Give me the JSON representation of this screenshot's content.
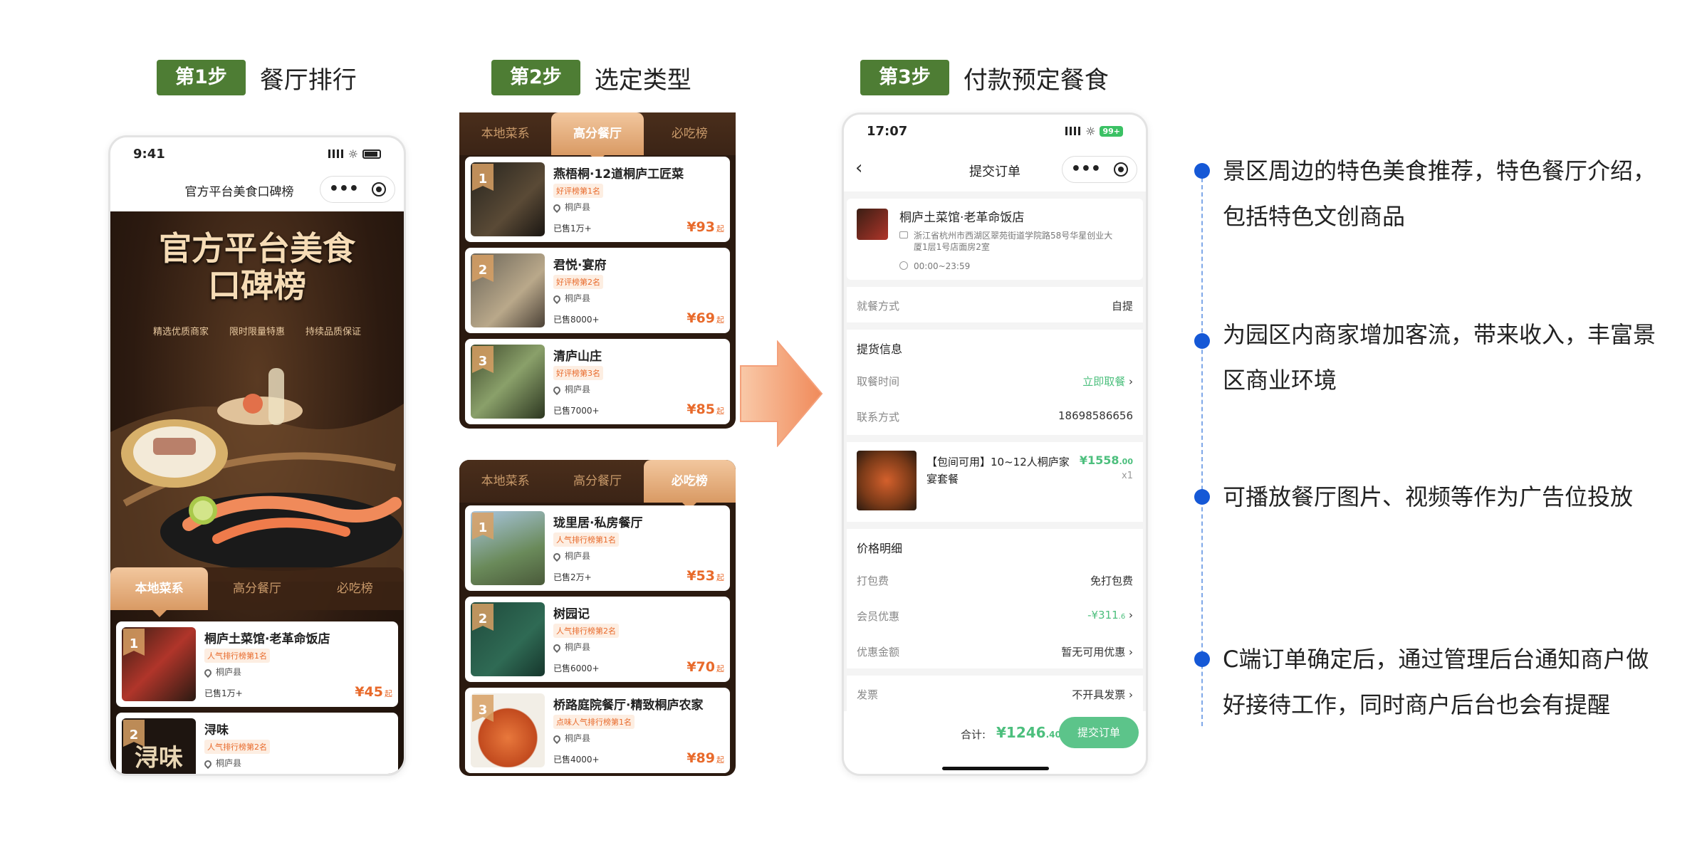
{
  "steps": [
    {
      "badge": "第1步",
      "title": "餐厅排行"
    },
    {
      "badge": "第2步",
      "title": "选定类型"
    },
    {
      "badge": "第3步",
      "title": "付款预定餐食"
    }
  ],
  "phone1": {
    "time": "9:41",
    "nav_title": "官方平台美食口碑榜",
    "hero_title_line1": "官方平台美食",
    "hero_title_line2": "口碑榜",
    "hero_tags": [
      "精选优质商家",
      "限时限量特惠",
      "持续品质保证"
    ],
    "tabs": [
      "本地菜系",
      "高分餐厅",
      "必吃榜"
    ],
    "active_tab": 0,
    "items": [
      {
        "rank": "1",
        "name": "桐庐土菜馆·老革命饭店",
        "tag": "人气排行榜第1名",
        "location": "桐庐县",
        "sold": "已售1万+",
        "price": "¥45",
        "unit": "起"
      },
      {
        "rank": "2",
        "name": "浔味",
        "tag": "人气排行榜第2名",
        "location": "桐庐县",
        "sold": "",
        "price": "",
        "unit": ""
      }
    ],
    "thumb_text": [
      "浔味"
    ]
  },
  "list_a": {
    "tabs": [
      "本地菜系",
      "高分餐厅",
      "必吃榜"
    ],
    "active_tab": 1,
    "items": [
      {
        "rank": "1",
        "name": "燕梧桐·12道桐庐工匠菜",
        "tag": "好评榜第1名",
        "location": "桐庐县",
        "sold": "已售1万+",
        "price": "¥93",
        "unit": "起"
      },
      {
        "rank": "2",
        "name": "君悦·宴府",
        "tag": "好评榜第2名",
        "location": "桐庐县",
        "sold": "已售8000+",
        "price": "¥69",
        "unit": "起"
      },
      {
        "rank": "3",
        "name": "清庐山庄",
        "tag": "好评榜第3名",
        "location": "桐庐县",
        "sold": "已售7000+",
        "price": "¥85",
        "unit": "起"
      }
    ]
  },
  "list_b": {
    "tabs": [
      "本地菜系",
      "高分餐厅",
      "必吃榜"
    ],
    "active_tab": 2,
    "items": [
      {
        "rank": "1",
        "name": "珑里居·私房餐厅",
        "tag": "人气排行榜第1名",
        "location": "桐庐县",
        "sold": "已售2万+",
        "price": "¥53",
        "unit": "起"
      },
      {
        "rank": "2",
        "name": "树园记",
        "tag": "人气排行榜第2名",
        "location": "桐庐县",
        "sold": "已售6000+",
        "price": "¥70",
        "unit": "起"
      },
      {
        "rank": "3",
        "name": "桥路庭院餐厅·精致桐庐农家",
        "tag": "点味人气排行榜第1名",
        "location": "桐庐县",
        "sold": "已售4000+",
        "price": "¥89",
        "unit": "起"
      }
    ]
  },
  "order": {
    "time": "17:07",
    "battery": "99+",
    "nav_title": "提交订单",
    "shop_name": "桐庐土菜馆·老革命饭店",
    "shop_address": "浙江省杭州市西湖区翠苑街道学院路58号华星创业大厦1层1号店面房2室",
    "shop_hours": "00:00~23:59",
    "dine_label": "就餐方式",
    "dine_value": "自提",
    "pickup_title": "提货信息",
    "pickup_time_label": "取餐时间",
    "pickup_time_value": "立即取餐",
    "contact_label": "联系方式",
    "contact_value": "18698586656",
    "product_name": "【包间可用】10~12人桐庐家宴套餐",
    "product_price": "¥1558",
    "product_price_dec": ".00",
    "product_qty": "x1",
    "price_title": "价格明细",
    "pack_label": "打包费",
    "pack_value": "免打包费",
    "member_label": "会员优惠",
    "member_value": "-¥311",
    "member_value_dec": ".6",
    "coupon_label": "优惠金额",
    "coupon_value": "暂无可用优惠",
    "invoice_label": "发票",
    "invoice_value": "不开具发票",
    "total_label": "合计:",
    "total_value": "¥1246",
    "total_dec": ".40",
    "submit_label": "提交订单"
  },
  "bullets": [
    "景区周边的特色美食推荐，特色餐厅介绍，包括特色文创商品",
    "为园区内商家增加客流，带来收入，丰富景区商业环境",
    "可播放餐厅图片、视频等作为广告位投放",
    "C端订单确定后，通过管理后台通知商户做好接待工作，同时商户后台也会有提醒"
  ],
  "colors": {
    "badge": "#4e7d34",
    "accent": "#e86a2b",
    "green": "#5cc48a",
    "bullet": "#1558d6",
    "arrow": "#f4a07a"
  }
}
